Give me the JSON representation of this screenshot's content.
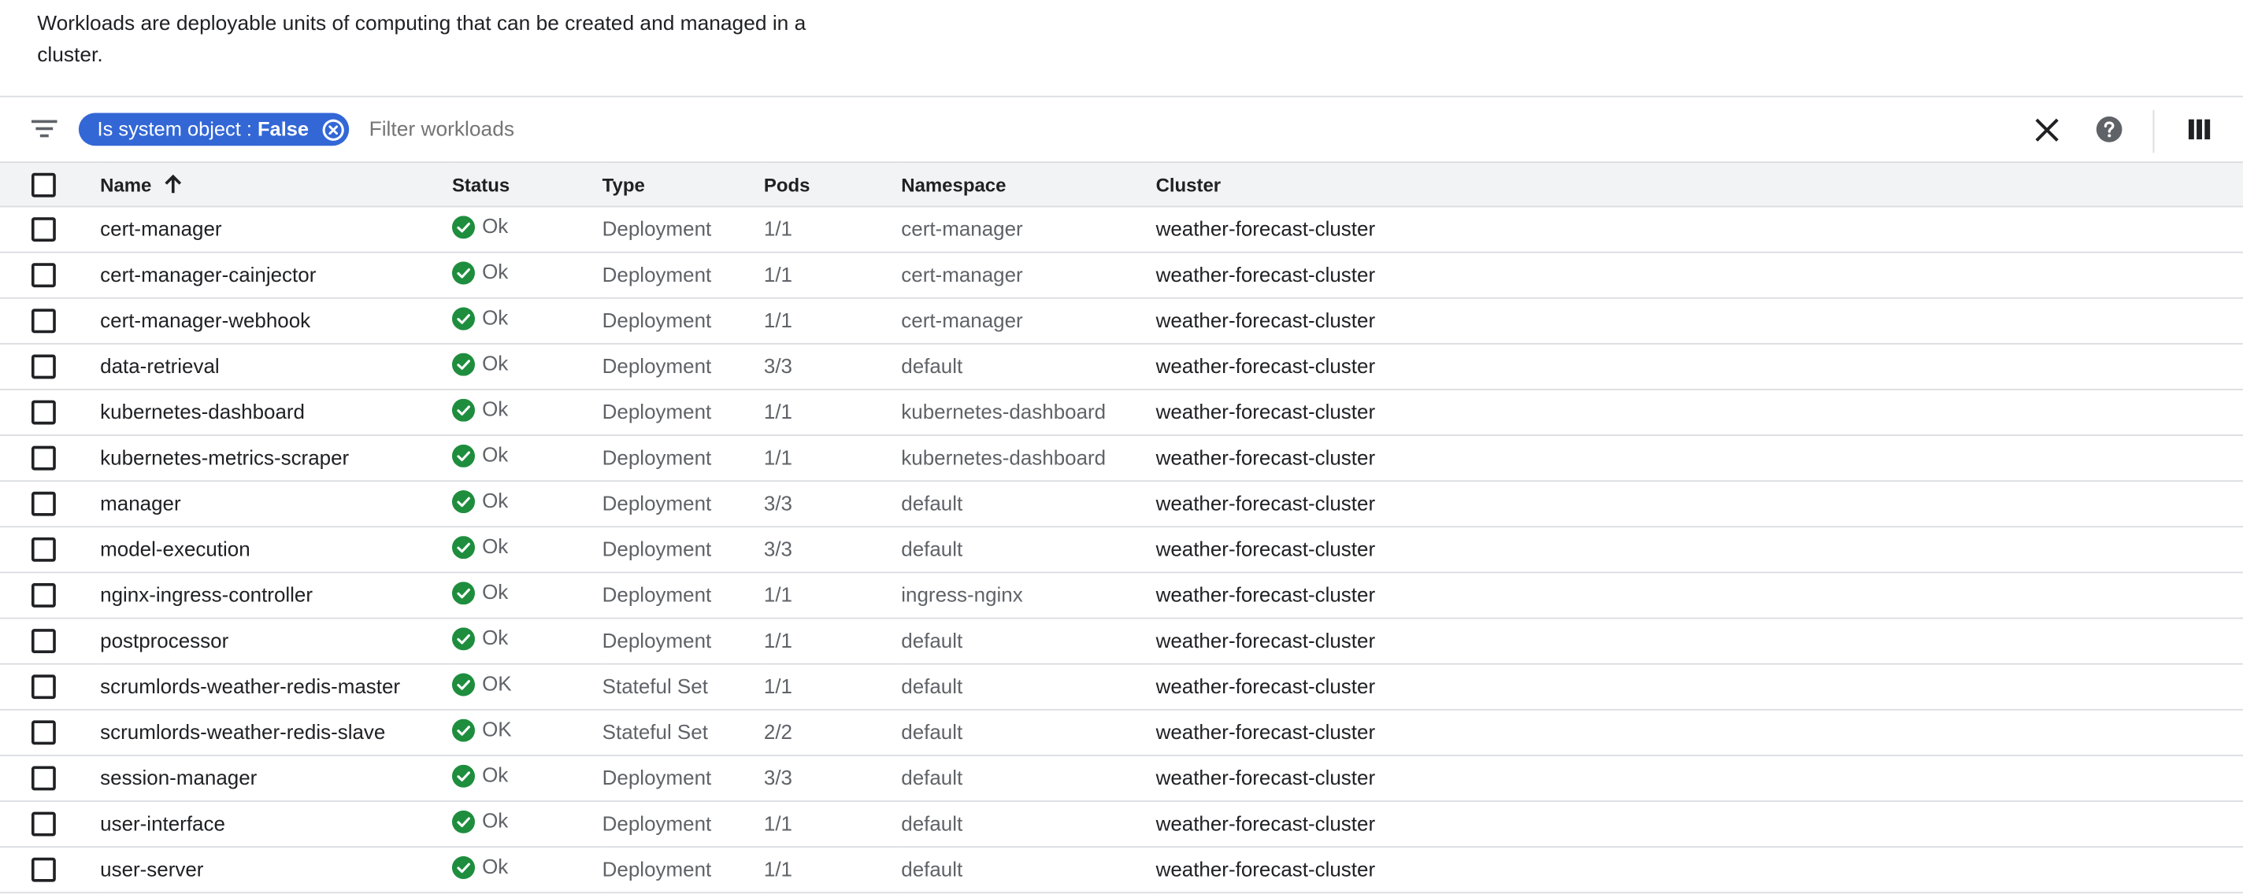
{
  "description": "Workloads are deployable units of computing that can be created and managed in a cluster.",
  "filter": {
    "chip_key": "Is system object : ",
    "chip_value": "False",
    "placeholder": "Filter workloads"
  },
  "table": {
    "columns": {
      "name": "Name",
      "status": "Status",
      "type": "Type",
      "pods": "Pods",
      "namespace": "Namespace",
      "cluster": "Cluster"
    },
    "sort": {
      "column": "name",
      "direction": "ascending"
    },
    "rows": [
      {
        "name": "cert-manager",
        "status": "Ok",
        "type": "Deployment",
        "pods": "1/1",
        "namespace": "cert-manager",
        "cluster": "weather-forecast-cluster"
      },
      {
        "name": "cert-manager-cainjector",
        "status": "Ok",
        "type": "Deployment",
        "pods": "1/1",
        "namespace": "cert-manager",
        "cluster": "weather-forecast-cluster"
      },
      {
        "name": "cert-manager-webhook",
        "status": "Ok",
        "type": "Deployment",
        "pods": "1/1",
        "namespace": "cert-manager",
        "cluster": "weather-forecast-cluster"
      },
      {
        "name": "data-retrieval",
        "status": "Ok",
        "type": "Deployment",
        "pods": "3/3",
        "namespace": "default",
        "cluster": "weather-forecast-cluster"
      },
      {
        "name": "kubernetes-dashboard",
        "status": "Ok",
        "type": "Deployment",
        "pods": "1/1",
        "namespace": "kubernetes-dashboard",
        "cluster": "weather-forecast-cluster"
      },
      {
        "name": "kubernetes-metrics-scraper",
        "status": "Ok",
        "type": "Deployment",
        "pods": "1/1",
        "namespace": "kubernetes-dashboard",
        "cluster": "weather-forecast-cluster"
      },
      {
        "name": "manager",
        "status": "Ok",
        "type": "Deployment",
        "pods": "3/3",
        "namespace": "default",
        "cluster": "weather-forecast-cluster"
      },
      {
        "name": "model-execution",
        "status": "Ok",
        "type": "Deployment",
        "pods": "3/3",
        "namespace": "default",
        "cluster": "weather-forecast-cluster"
      },
      {
        "name": "nginx-ingress-controller",
        "status": "Ok",
        "type": "Deployment",
        "pods": "1/1",
        "namespace": "ingress-nginx",
        "cluster": "weather-forecast-cluster"
      },
      {
        "name": "postprocessor",
        "status": "Ok",
        "type": "Deployment",
        "pods": "1/1",
        "namespace": "default",
        "cluster": "weather-forecast-cluster"
      },
      {
        "name": "scrumlords-weather-redis-master",
        "status": "OK",
        "type": "Stateful Set",
        "pods": "1/1",
        "namespace": "default",
        "cluster": "weather-forecast-cluster"
      },
      {
        "name": "scrumlords-weather-redis-slave",
        "status": "OK",
        "type": "Stateful Set",
        "pods": "2/2",
        "namespace": "default",
        "cluster": "weather-forecast-cluster"
      },
      {
        "name": "session-manager",
        "status": "Ok",
        "type": "Deployment",
        "pods": "3/3",
        "namespace": "default",
        "cluster": "weather-forecast-cluster"
      },
      {
        "name": "user-interface",
        "status": "Ok",
        "type": "Deployment",
        "pods": "1/1",
        "namespace": "default",
        "cluster": "weather-forecast-cluster"
      },
      {
        "name": "user-server",
        "status": "Ok",
        "type": "Deployment",
        "pods": "1/1",
        "namespace": "default",
        "cluster": "weather-forecast-cluster"
      }
    ]
  },
  "icons": {
    "filter": "filter-list-icon",
    "chip_close": "cancel-circle-icon",
    "clear": "close-icon",
    "help": "help-circle-icon",
    "columns": "view-column-icon",
    "sort": "arrow-upward-icon",
    "status_ok": "check-circle-icon"
  },
  "colors": {
    "chip": "#3367d6",
    "status_ok": "#1e8e3e",
    "header_bg": "#f1f3f4",
    "divider": "#dadce0"
  }
}
